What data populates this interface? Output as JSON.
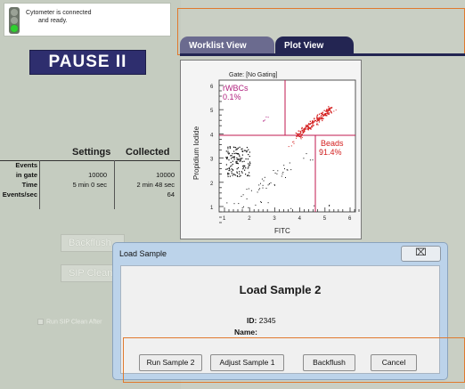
{
  "status": {
    "line1": "Cytometer is connected",
    "line2": "and ready."
  },
  "pause_label": "PAUSE II",
  "stats": {
    "col_settings": "Settings",
    "col_collected": "Collected",
    "rows": [
      {
        "label": "Events",
        "settings": "",
        "collected": ""
      },
      {
        "label": "in gate",
        "settings": "10000",
        "collected": "10000"
      },
      {
        "label": "Time",
        "settings": "5 min 0 sec",
        "collected": "2 min 48 sec"
      },
      {
        "label": "Events/sec",
        "settings": "",
        "collected": "64"
      }
    ]
  },
  "disabled_buttons": {
    "backflush": "Backflush",
    "sip_clean": "SIP Clean"
  },
  "run_sip_label": "Run SIP Clean After",
  "tabs": {
    "worklist": "Worklist View",
    "plot": "Plot View"
  },
  "plot": {
    "gate_text": "Gate:  [No Gating]",
    "ylabel": "Propidium Iodide",
    "xlabel": "FITC",
    "rwbc_label": "rWBCs",
    "rwbc_pct": "0.1%",
    "beads_label": "Beads",
    "beads_pct": "91.4%",
    "ticks_y": [
      "6",
      "5",
      "4",
      "3",
      "2",
      "1"
    ],
    "ticks_x": [
      "1",
      "2",
      "3",
      "4",
      "5",
      "6"
    ],
    "colors": {
      "gate_line": "#c2184f",
      "rwbc": "#b0207d",
      "beads": "#d42020",
      "events": "#111111"
    }
  },
  "dialog": {
    "title": "Load Sample",
    "close_glyph": "⌧",
    "heading": "Load Sample 2",
    "id_label": "ID:",
    "id_value": "2345",
    "name_label": "Name:",
    "name_value": "",
    "buttons": {
      "run": "Run Sample 2",
      "adjust": "Adjust Sample 1",
      "backflush": "Backflush",
      "cancel": "Cancel"
    }
  },
  "colors": {
    "accent_orange": "#e07a2e",
    "tab_active": "#232552",
    "tab_inactive": "#6b6b8f",
    "pause_bg": "#2e2e6e"
  }
}
